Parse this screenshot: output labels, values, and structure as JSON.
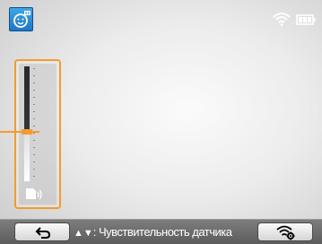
{
  "status_bar": {
    "mode_icon": "smart-face-mode-icon",
    "wifi_icon": "wifi-icon",
    "battery_icon": "battery-full-icon"
  },
  "sensitivity_panel": {
    "icon": "microphone-sensor-icon",
    "level_fraction": 0.43
  },
  "bottom_bar": {
    "back_icon": "back-arrow-icon",
    "hint_arrows": "▲▼",
    "hint_text": ": Чувствительность датчика",
    "settings_icon": "wifi-settings-icon"
  },
  "colors": {
    "accent": "#f39b2e",
    "mode_icon_bg": "#2b8ad6",
    "bar_bg": "#6b6b6b"
  }
}
